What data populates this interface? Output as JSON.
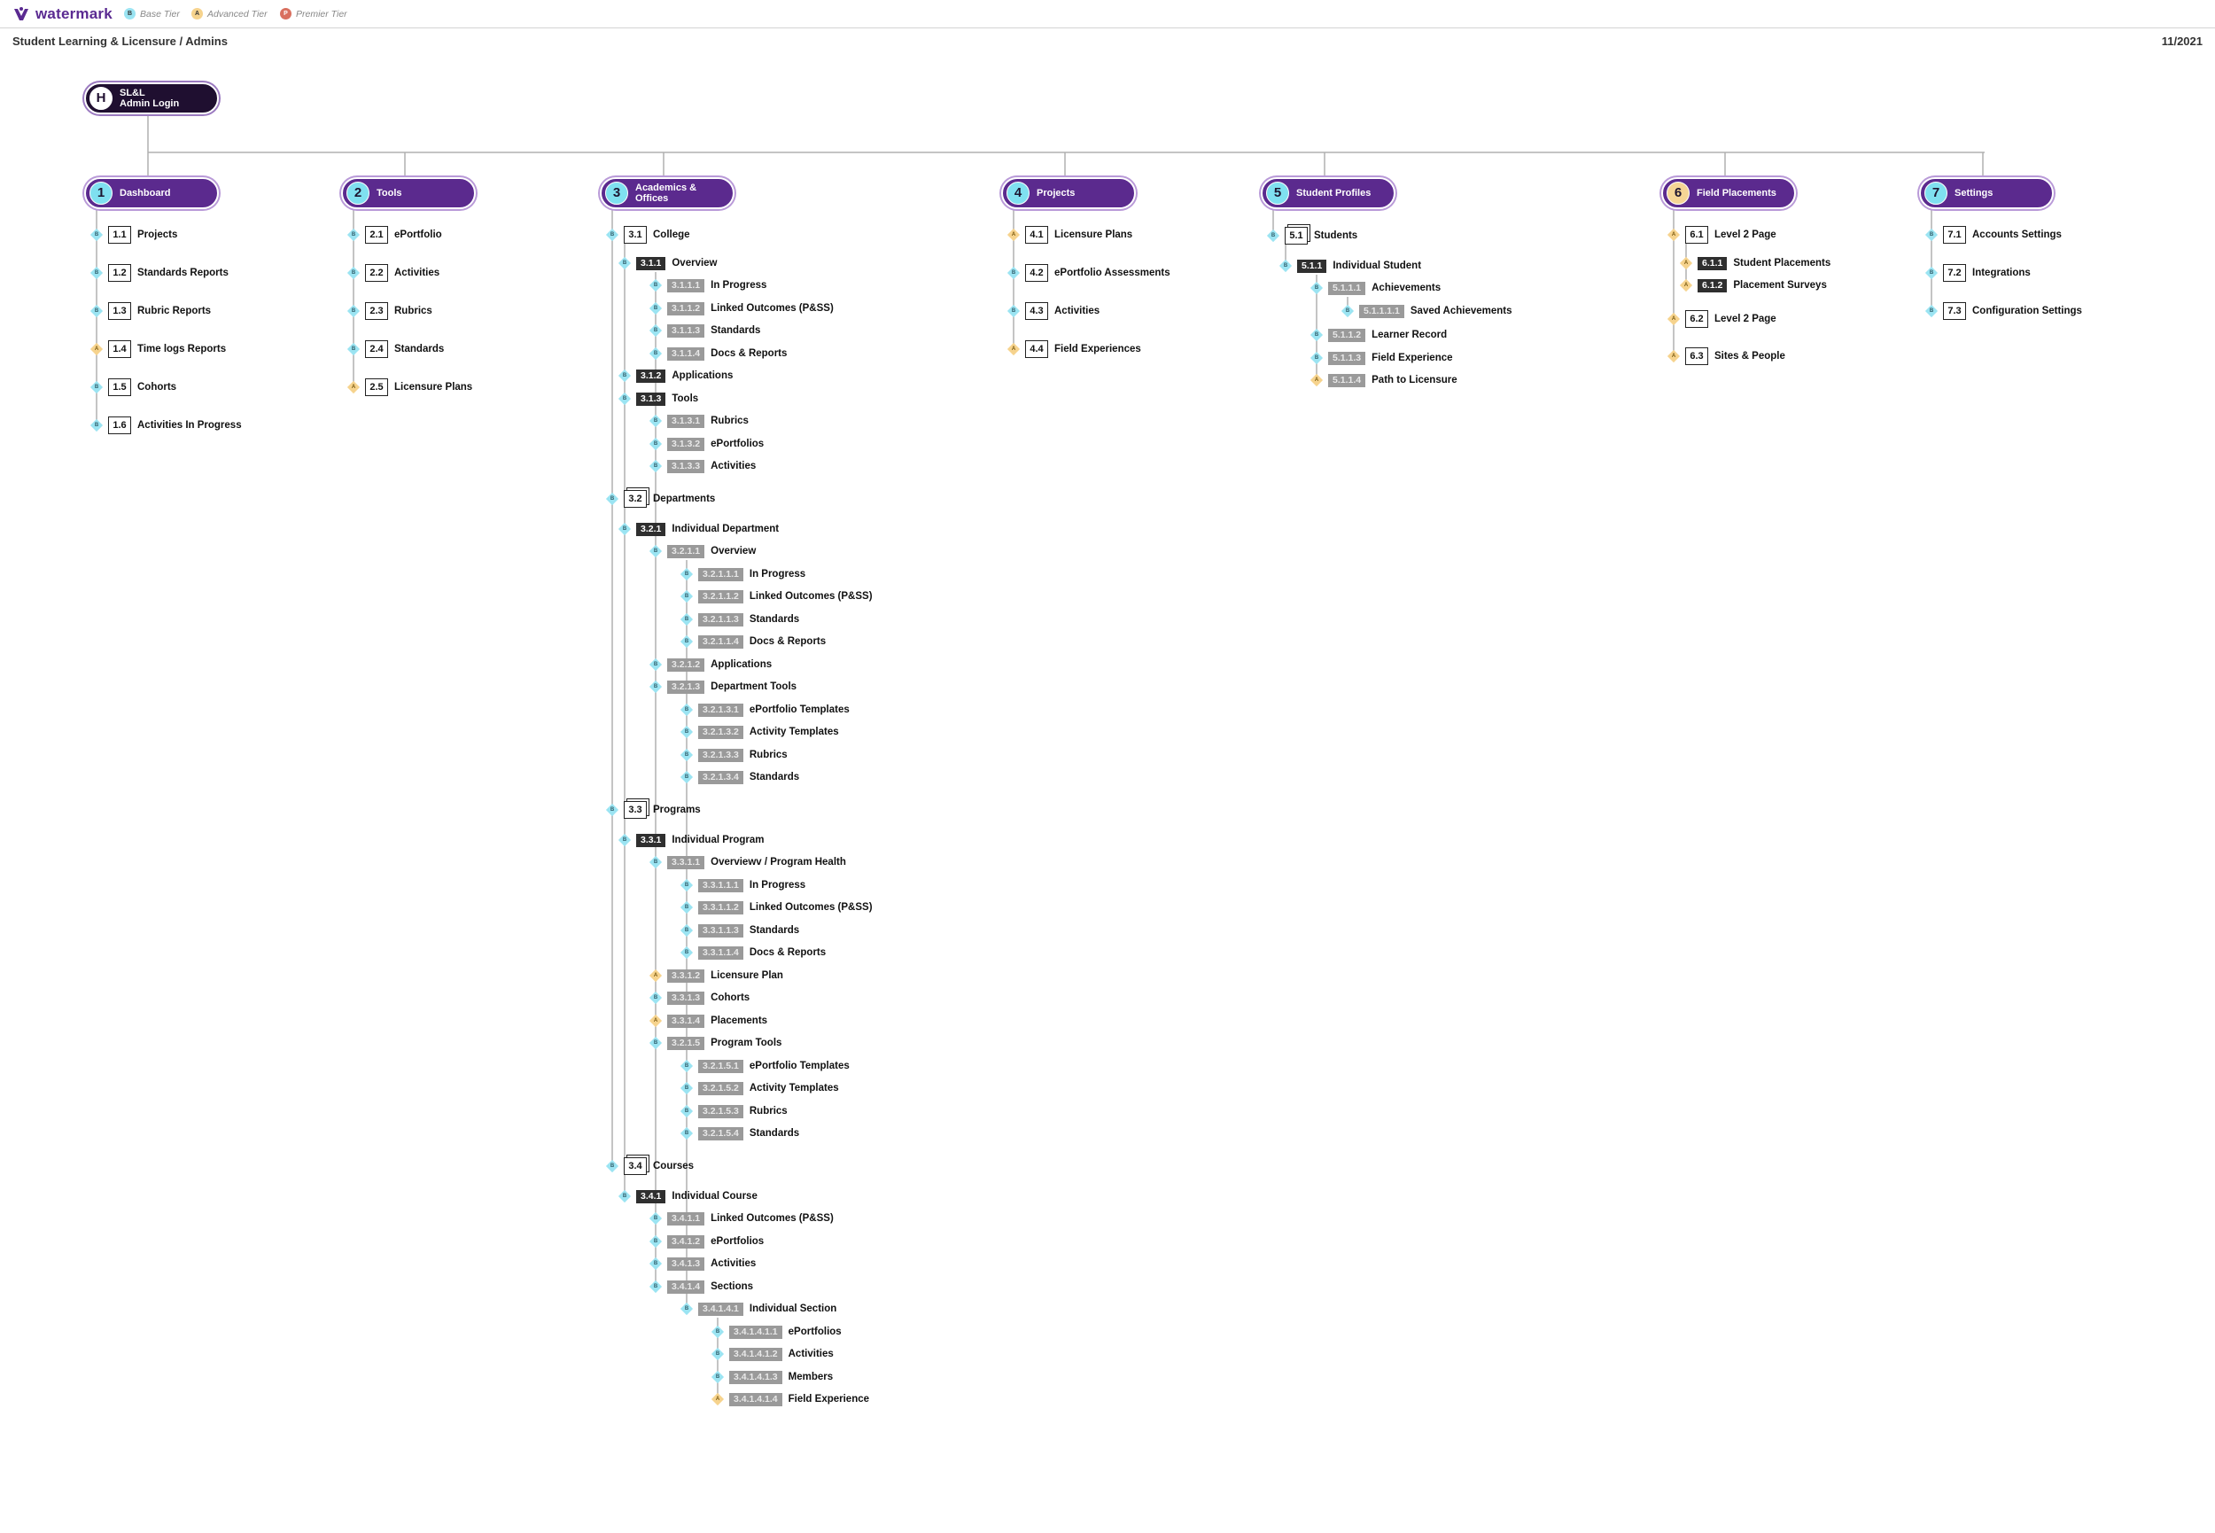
{
  "header": {
    "logo_text": "watermark",
    "legend": [
      {
        "letter": "B",
        "label": "Base Tier",
        "color": "#9be4f2"
      },
      {
        "letter": "A",
        "label": "Advanced Tier",
        "color": "#f6d38d"
      },
      {
        "letter": "P",
        "label": "Premier Tier",
        "color": "#d9705f"
      }
    ],
    "subtitle": "Student Learning & Licensure / Admins",
    "date": "11/2021"
  },
  "colors": {
    "primary": "#5b2a8e",
    "home": "#1f0f30",
    "base": "#9be4f2",
    "advanced": "#f6d38d"
  },
  "home": {
    "badge": "H",
    "label": "SL&L\nAdmin Login"
  },
  "sections": [
    {
      "badge": "1",
      "label": "Dashboard",
      "tier": "B",
      "items": [
        {
          "id": "1.1",
          "label": "Projects",
          "tier": "B"
        },
        {
          "id": "1.2",
          "label": "Standards Reports",
          "tier": "B"
        },
        {
          "id": "1.3",
          "label": "Rubric Reports",
          "tier": "B"
        },
        {
          "id": "1.4",
          "label": "Time logs Reports",
          "tier": "A"
        },
        {
          "id": "1.5",
          "label": "Cohorts",
          "tier": "B"
        },
        {
          "id": "1.6",
          "label": "Activities In Progress",
          "tier": "B"
        }
      ]
    },
    {
      "badge": "2",
      "label": "Tools",
      "tier": "B",
      "items": [
        {
          "id": "2.1",
          "label": "ePortfolio",
          "tier": "B"
        },
        {
          "id": "2.2",
          "label": "Activities",
          "tier": "B"
        },
        {
          "id": "2.3",
          "label": "Rubrics",
          "tier": "B"
        },
        {
          "id": "2.4",
          "label": "Standards",
          "tier": "B"
        },
        {
          "id": "2.5",
          "label": "Licensure Plans",
          "tier": "A"
        }
      ]
    },
    {
      "badge": "3",
      "label": "Academics &\nOffices",
      "tier": "B",
      "items": [
        {
          "id": "3.1",
          "label": "College",
          "tier": "B"
        },
        {
          "id": "3.1.1",
          "label": "Overview",
          "tier": "B"
        },
        {
          "id": "3.1.1.1",
          "label": "In Progress",
          "tier": "B"
        },
        {
          "id": "3.1.1.2",
          "label": "Linked Outcomes (P&SS)",
          "tier": "B"
        },
        {
          "id": "3.1.1.3",
          "label": "Standards",
          "tier": "B"
        },
        {
          "id": "3.1.1.4",
          "label": "Docs & Reports",
          "tier": "B"
        },
        {
          "id": "3.1.2",
          "label": "Applications",
          "tier": "B"
        },
        {
          "id": "3.1.3",
          "label": "Tools",
          "tier": "B"
        },
        {
          "id": "3.1.3.1",
          "label": "Rubrics",
          "tier": "B"
        },
        {
          "id": "3.1.3.2",
          "label": "ePortfolios",
          "tier": "B"
        },
        {
          "id": "3.1.3.3",
          "label": "Activities",
          "tier": "B"
        },
        {
          "id": "3.2",
          "label": "Departments",
          "tier": "B"
        },
        {
          "id": "3.2.1",
          "label": "Individual Department",
          "tier": "B"
        },
        {
          "id": "3.2.1.1",
          "label": "Overview",
          "tier": "B"
        },
        {
          "id": "3.2.1.1.1",
          "label": "In Progress",
          "tier": "B"
        },
        {
          "id": "3.2.1.1.2",
          "label": "Linked Outcomes (P&SS)",
          "tier": "B"
        },
        {
          "id": "3.2.1.1.3",
          "label": "Standards",
          "tier": "B"
        },
        {
          "id": "3.2.1.1.4",
          "label": "Docs & Reports",
          "tier": "B"
        },
        {
          "id": "3.2.1.2",
          "label": "Applications",
          "tier": "B"
        },
        {
          "id": "3.2.1.3",
          "label": "Department Tools",
          "tier": "B"
        },
        {
          "id": "3.2.1.3.1",
          "label": "ePortfolio Templates",
          "tier": "B"
        },
        {
          "id": "3.2.1.3.2",
          "label": "Activity Templates",
          "tier": "B"
        },
        {
          "id": "3.2.1.3.3",
          "label": "Rubrics",
          "tier": "B"
        },
        {
          "id": "3.2.1.3.4",
          "label": "Standards",
          "tier": "B"
        },
        {
          "id": "3.3",
          "label": "Programs",
          "tier": "B"
        },
        {
          "id": "3.3.1",
          "label": "Individual Program",
          "tier": "B"
        },
        {
          "id": "3.3.1.1",
          "label": "Overviewv / Program Health",
          "tier": "B"
        },
        {
          "id": "3.3.1.1.1",
          "label": "In Progress",
          "tier": "B"
        },
        {
          "id": "3.3.1.1.2",
          "label": "Linked Outcomes (P&SS)",
          "tier": "B"
        },
        {
          "id": "3.3.1.1.3",
          "label": "Standards",
          "tier": "B"
        },
        {
          "id": "3.3.1.1.4",
          "label": "Docs & Reports",
          "tier": "B"
        },
        {
          "id": "3.3.1.2",
          "label": "Licensure Plan",
          "tier": "A"
        },
        {
          "id": "3.3.1.3",
          "label": "Cohorts",
          "tier": "B"
        },
        {
          "id": "3.3.1.4",
          "label": "Placements",
          "tier": "A"
        },
        {
          "id": "3.2.1.5",
          "label": "Program Tools",
          "tier": "B"
        },
        {
          "id": "3.2.1.5.1",
          "label": "ePortfolio Templates",
          "tier": "B"
        },
        {
          "id": "3.2.1.5.2",
          "label": "Activity Templates",
          "tier": "B"
        },
        {
          "id": "3.2.1.5.3",
          "label": "Rubrics",
          "tier": "B"
        },
        {
          "id": "3.2.1.5.4",
          "label": "Standards",
          "tier": "B"
        },
        {
          "id": "3.4",
          "label": "Courses",
          "tier": "B"
        },
        {
          "id": "3.4.1",
          "label": "Individual Course",
          "tier": "B"
        },
        {
          "id": "3.4.1.1",
          "label": "Linked Outcomes (P&SS)",
          "tier": "B"
        },
        {
          "id": "3.4.1.2",
          "label": "ePortfolios",
          "tier": "B"
        },
        {
          "id": "3.4.1.3",
          "label": "Activities",
          "tier": "B"
        },
        {
          "id": "3.4.1.4",
          "label": "Sections",
          "tier": "B"
        },
        {
          "id": "3.4.1.4.1",
          "label": "Individual Section",
          "tier": "B"
        },
        {
          "id": "3.4.1.4.1.1",
          "label": "ePortfolios",
          "tier": "B"
        },
        {
          "id": "3.4.1.4.1.2",
          "label": "Activities",
          "tier": "B"
        },
        {
          "id": "3.4.1.4.1.3",
          "label": "Members",
          "tier": "B"
        },
        {
          "id": "3.4.1.4.1.4",
          "label": "Field Experience",
          "tier": "A"
        }
      ]
    },
    {
      "badge": "4",
      "label": "Projects",
      "tier": "B",
      "items": [
        {
          "id": "4.1",
          "label": "Licensure Plans",
          "tier": "A"
        },
        {
          "id": "4.2",
          "label": "ePortfolio Assessments",
          "tier": "B"
        },
        {
          "id": "4.3",
          "label": "Activities",
          "tier": "B"
        },
        {
          "id": "4.4",
          "label": "Field Experiences",
          "tier": "A"
        }
      ]
    },
    {
      "badge": "5",
      "label": "Student Profiles",
      "tier": "B",
      "items": [
        {
          "id": "5.1",
          "label": "Students",
          "tier": "B"
        },
        {
          "id": "5.1.1",
          "label": "Individual Student",
          "tier": "B"
        },
        {
          "id": "5.1.1.1",
          "label": "Achievements",
          "tier": "B"
        },
        {
          "id": "5.1.1.1.1",
          "label": "Saved Achievements",
          "tier": "B"
        },
        {
          "id": "5.1.1.2",
          "label": "Learner Record",
          "tier": "B"
        },
        {
          "id": "5.1.1.3",
          "label": "Field Experience",
          "tier": "B"
        },
        {
          "id": "5.1.1.4",
          "label": "Path to Licensure",
          "tier": "A"
        }
      ]
    },
    {
      "badge": "6",
      "label": "Field Placements",
      "tier": "A",
      "items": [
        {
          "id": "6.1",
          "label": "Level 2 Page",
          "tier": "A"
        },
        {
          "id": "6.1.1",
          "label": "Student Placements",
          "tier": "A"
        },
        {
          "id": "6.1.2",
          "label": "Placement Surveys",
          "tier": "A"
        },
        {
          "id": "6.2",
          "label": "Level 2 Page",
          "tier": "A"
        },
        {
          "id": "6.3",
          "label": "Sites & People",
          "tier": "A"
        }
      ]
    },
    {
      "badge": "7",
      "label": "Settings",
      "tier": "B",
      "items": [
        {
          "id": "7.1",
          "label": "Accounts Settings",
          "tier": "B"
        },
        {
          "id": "7.2",
          "label": "Integrations",
          "tier": "B"
        },
        {
          "id": "7.3",
          "label": "Configuration Settings",
          "tier": "B"
        }
      ]
    }
  ]
}
